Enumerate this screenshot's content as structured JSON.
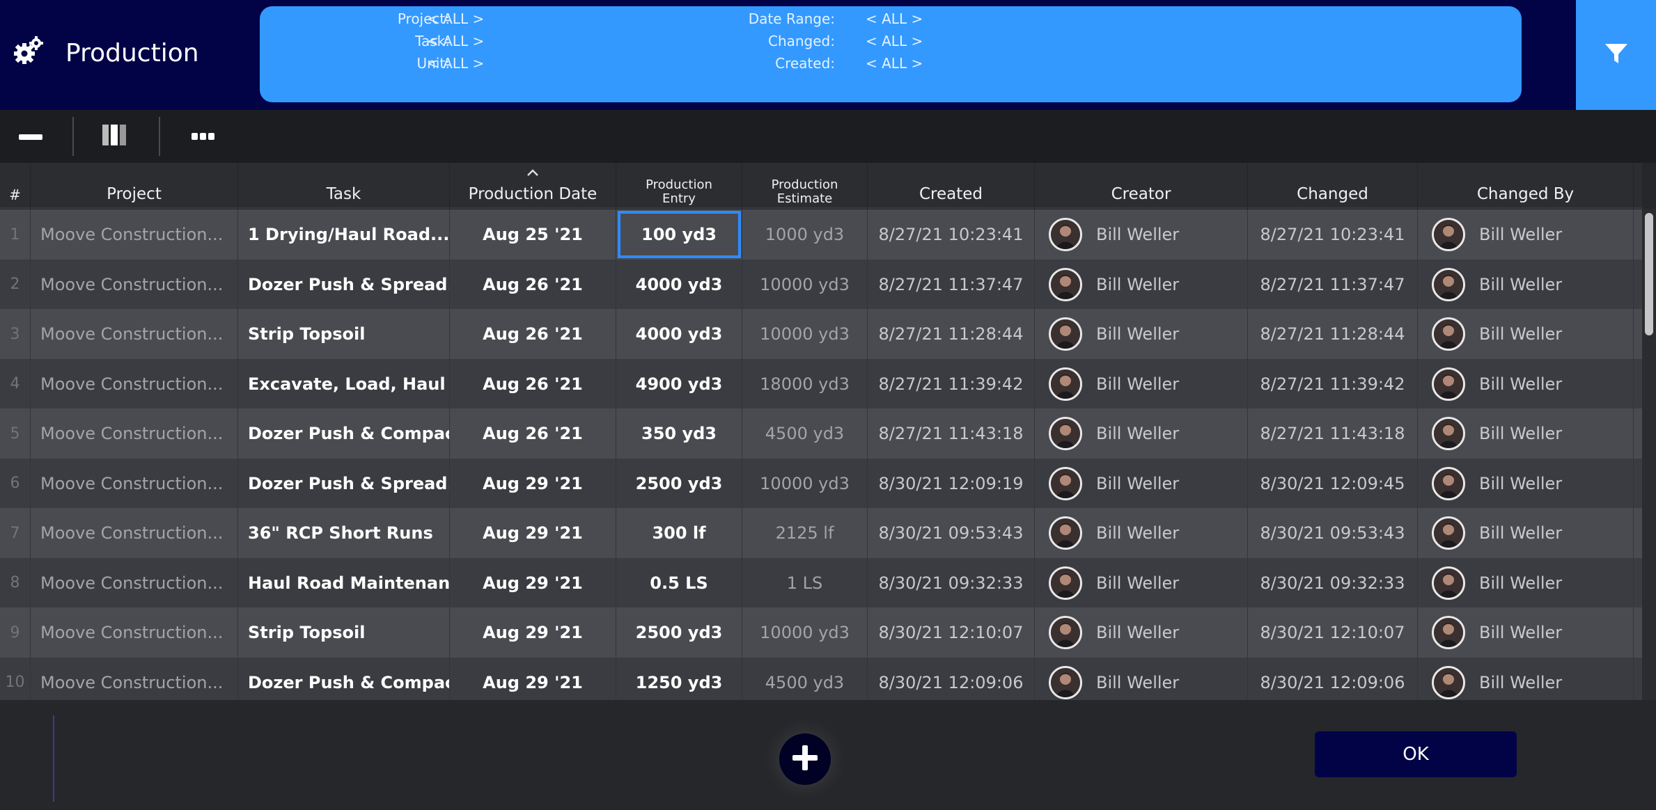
{
  "app": {
    "title": "Production",
    "icon": "gears-icon"
  },
  "filters": {
    "left": [
      {
        "label": "Project:",
        "value": "< ALL >"
      },
      {
        "label": "Task:",
        "value": "< ALL >"
      },
      {
        "label": "Unit:",
        "value": "< ALL >"
      }
    ],
    "right": [
      {
        "label": "Date Range:",
        "value": "< ALL >"
      },
      {
        "label": "Changed:",
        "value": "< ALL >"
      },
      {
        "label": "Created:",
        "value": "< ALL >"
      }
    ],
    "button_icon": "funnel-icon"
  },
  "toolbar": {
    "icons": [
      "minus-icon",
      "columns-icon",
      "more-icon"
    ]
  },
  "table": {
    "columns": [
      "#",
      "Project",
      "Task",
      "Production Date",
      "Production Entry",
      "Production Estimate",
      "Created",
      "Creator",
      "Changed",
      "Changed By"
    ],
    "sorted_column": "Production Date",
    "sort_icon": "sort-ascending-icon",
    "selected_cell": {
      "row": 1,
      "column": "Production Entry"
    },
    "rows": [
      {
        "num": "1",
        "project": "Moove Construction...",
        "task": "1 Drying/Haul Road...",
        "date": "Aug 25 '21",
        "entry": "100 yd3",
        "estimate": "1000 yd3",
        "created": "8/27/21  10:23:41",
        "creator": "Bill Weller",
        "changed": "8/27/21  10:23:41",
        "changed_by": "Bill Weller"
      },
      {
        "num": "2",
        "project": "Moove Construction...",
        "task": "Dozer Push & Spread...",
        "date": "Aug 26 '21",
        "entry": "4000 yd3",
        "estimate": "10000 yd3",
        "created": "8/27/21  11:37:47",
        "creator": "Bill Weller",
        "changed": "8/27/21  11:37:47",
        "changed_by": "Bill Weller"
      },
      {
        "num": "3",
        "project": "Moove Construction...",
        "task": "Strip Topsoil",
        "date": "Aug 26 '21",
        "entry": "4000 yd3",
        "estimate": "10000 yd3",
        "created": "8/27/21  11:28:44",
        "creator": "Bill Weller",
        "changed": "8/27/21  11:28:44",
        "changed_by": "Bill Weller"
      },
      {
        "num": "4",
        "project": "Moove Construction...",
        "task": "Excavate, Load, Haul &...",
        "date": "Aug 26 '21",
        "entry": "4900 yd3",
        "estimate": "18000 yd3",
        "created": "8/27/21  11:39:42",
        "creator": "Bill Weller",
        "changed": "8/27/21  11:39:42",
        "changed_by": "Bill Weller"
      },
      {
        "num": "5",
        "project": "Moove Construction...",
        "task": "Dozer Push & Compact...",
        "date": "Aug 26 '21",
        "entry": "350 yd3",
        "estimate": "4500 yd3",
        "created": "8/27/21  11:43:18",
        "creator": "Bill Weller",
        "changed": "8/27/21  11:43:18",
        "changed_by": "Bill Weller"
      },
      {
        "num": "6",
        "project": "Moove Construction...",
        "task": "Dozer Push & Spread...",
        "date": "Aug 29 '21",
        "entry": "2500 yd3",
        "estimate": "10000 yd3",
        "created": "8/30/21  12:09:19",
        "creator": "Bill Weller",
        "changed": "8/30/21  12:09:45",
        "changed_by": "Bill Weller"
      },
      {
        "num": "7",
        "project": "Moove Construction...",
        "task": "36\" RCP Short Runs",
        "date": "Aug 29 '21",
        "entry": "300 lf",
        "estimate": "2125 lf",
        "created": "8/30/21  09:53:43",
        "creator": "Bill Weller",
        "changed": "8/30/21  09:53:43",
        "changed_by": "Bill Weller"
      },
      {
        "num": "8",
        "project": "Moove Construction...",
        "task": "Haul Road Maintenance",
        "date": "Aug 29 '21",
        "entry": "0.5 LS",
        "estimate": "1 LS",
        "created": "8/30/21  09:32:33",
        "creator": "Bill Weller",
        "changed": "8/30/21  09:32:33",
        "changed_by": "Bill Weller"
      },
      {
        "num": "9",
        "project": "Moove Construction...",
        "task": "Strip Topsoil",
        "date": "Aug 29 '21",
        "entry": "2500 yd3",
        "estimate": "10000 yd3",
        "created": "8/30/21  12:10:07",
        "creator": "Bill Weller",
        "changed": "8/30/21  12:10:07",
        "changed_by": "Bill Weller"
      },
      {
        "num": "10",
        "project": "Moove Construction...",
        "task": "Dozer Push & Compact...",
        "date": "Aug 29 '21",
        "entry": "1250 yd3",
        "estimate": "4500 yd3",
        "created": "8/30/21  12:09:06",
        "creator": "Bill Weller",
        "changed": "8/30/21  12:09:06",
        "changed_by": "Bill Weller"
      }
    ]
  },
  "footer": {
    "add_icon": "plus-icon",
    "ok_label": "OK"
  },
  "colors": {
    "header_bg": "#020347",
    "accent": "#3399ff",
    "selection": "#2e8bff",
    "row_odd": "#4a4b50",
    "row_even": "#3b3c41"
  }
}
